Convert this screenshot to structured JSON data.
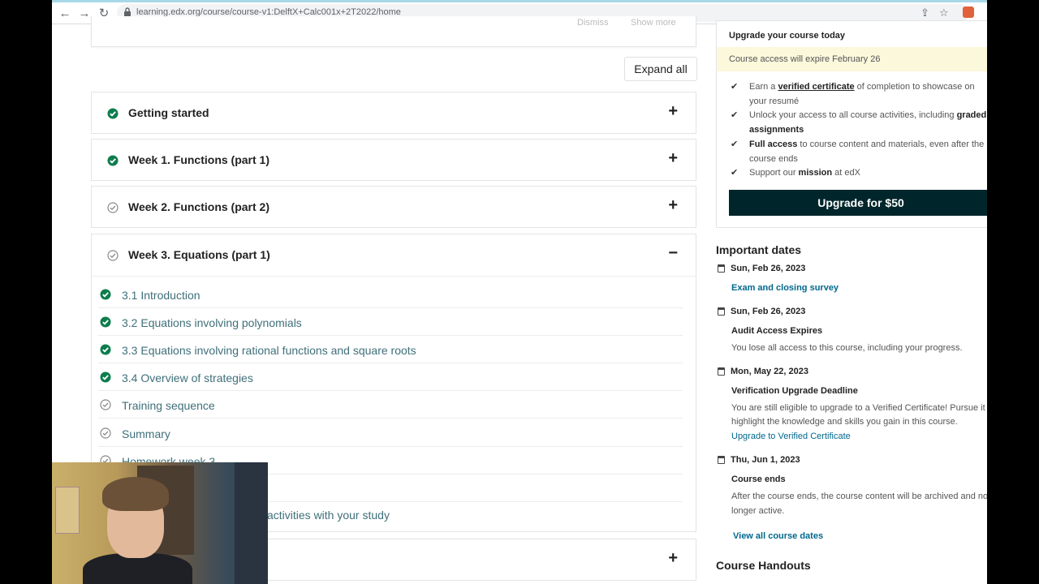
{
  "browser": {
    "url": "learning.edx.org/course/course-v1:DelftX+Calc001x+2T2022/home"
  },
  "top_card": {
    "faint_left": "Dismiss",
    "faint_right": "Show more"
  },
  "expand_all": "Expand all",
  "sections": [
    {
      "title": "Getting started",
      "complete": true,
      "toggle": "+"
    },
    {
      "title": "Week 1. Functions (part 1)",
      "complete": true,
      "toggle": "+"
    },
    {
      "title": "Week 2. Functions (part 2)",
      "complete": false,
      "toggle": "+"
    },
    {
      "title": "Week 3. Equations (part 1)",
      "complete": false,
      "toggle": "−"
    }
  ],
  "week3_items": [
    {
      "label": "3.1 Introduction",
      "complete": true
    },
    {
      "label": "3.2 Equations involving polynomials",
      "complete": true
    },
    {
      "label": "3.3 Equations involving rational functions and square roots",
      "complete": true
    },
    {
      "label": "3.4 Overview of strategies",
      "complete": true
    },
    {
      "label": "Training sequence",
      "complete": false
    },
    {
      "label": "Summary",
      "complete": false
    },
    {
      "label": "Homework week 3",
      "complete": false
    }
  ],
  "partial_item": "activities with your study",
  "next_section_toggle": "+",
  "upgrade": {
    "title": "Upgrade your course today",
    "expire": "Course access will expire February 26",
    "benefit1_pre": "Earn a ",
    "benefit1_link": "verified certificate",
    "benefit1_post": " of completion to showcase on your resumé",
    "benefit2_pre": "Unlock your access to all course activities, including ",
    "benefit2_bold": "graded assignments",
    "benefit3_bold": "Full access",
    "benefit3_post": " to course content and materials, even after the course ends",
    "benefit4_pre": "Support our ",
    "benefit4_bold": "mission",
    "benefit4_post": " at edX",
    "button": "Upgrade for $50"
  },
  "important_dates": {
    "title": "Important dates",
    "entries": [
      {
        "date": "Sun, Feb 26, 2023",
        "name": "Exam and closing survey",
        "desc": ""
      },
      {
        "date": "Sun, Feb 26, 2023",
        "name": "Audit Access Expires",
        "desc": "You lose all access to this course, including your progress."
      },
      {
        "date": "Mon, May 22, 2023",
        "name": "Verification Upgrade Deadline",
        "desc1": "You are still eligible to upgrade to a Verified Certificate! Pursue it to",
        "desc2": "highlight the knowledge and skills you gain in this course.",
        "link": "Upgrade to Verified Certificate"
      },
      {
        "date": "Thu, Jun 1, 2023",
        "name": "Course ends",
        "desc1": "After the course ends, the course content will be archived and no",
        "desc2": "longer active."
      }
    ],
    "view_all": "View all course dates"
  },
  "handouts_title": "Course Handouts",
  "colors": {
    "check_green": "#0d7d4d",
    "check_gray": "#888888",
    "link": "#00688d",
    "upgrade_bg": "#00262b"
  }
}
